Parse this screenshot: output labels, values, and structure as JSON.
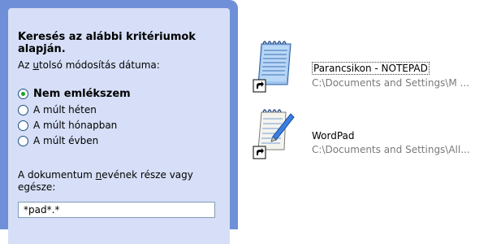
{
  "search_panel": {
    "heading": "Keresés az alábbi kritériumok alapján.",
    "date_label_pre": "Az ",
    "date_label_u": "u",
    "date_label_post": "tolsó módosítás dátuma:",
    "options": [
      {
        "label": "Nem emlékszem",
        "checked": true
      },
      {
        "label": "A múlt héten",
        "checked": false
      },
      {
        "label": "A múlt hónapban",
        "checked": false
      },
      {
        "label": "A múlt évben",
        "checked": false
      }
    ],
    "name_label_pre": "A dokumentum ",
    "name_label_u": "n",
    "name_label_post": "evének része vagy egésze:",
    "name_value": "*pad*.*"
  },
  "results": [
    {
      "title": "Parancsikon - NOTEPAD",
      "path": "C:\\Documents and Settings\\M ...",
      "icon": "notepad-shortcut-icon"
    },
    {
      "title": "WordPad",
      "path": "C:\\Documents and Settings\\All...",
      "icon": "wordpad-shortcut-icon"
    }
  ],
  "colors": {
    "panel_frame": "#6f8fd8",
    "panel_bg": "#d6dff7",
    "radio_dot": "#21a121"
  }
}
